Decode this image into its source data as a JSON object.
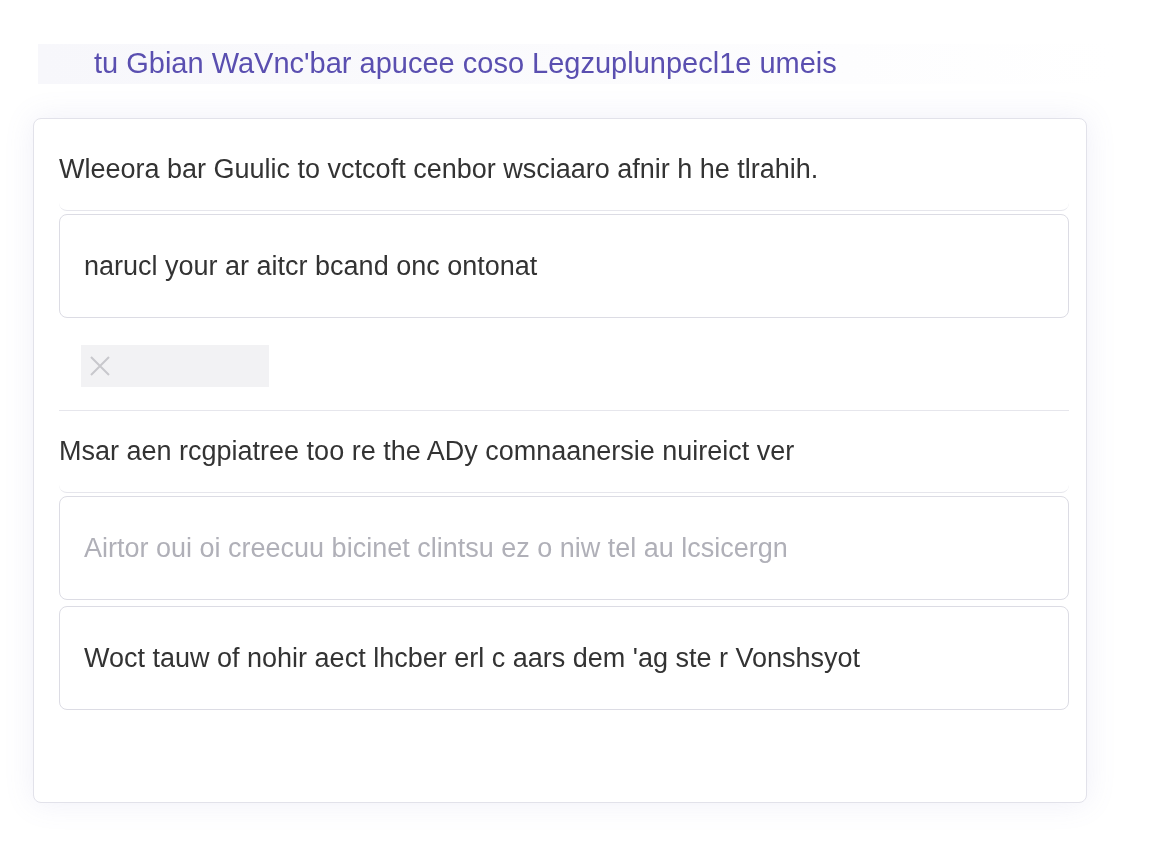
{
  "title": "tu Gbian WaVnc'bar apucee coso Legzuplunpecl1e umeis",
  "rows": [
    {
      "kind": "text",
      "text": "Wleeora bar Guulic to vctcoft cenbor wsciaaro afnir h he tlrahih."
    },
    {
      "kind": "field",
      "value": "narucl your ar aitcr bcand onc ontonat"
    },
    {
      "kind": "attach"
    },
    {
      "kind": "text",
      "text": "Msar aen rcgpiatree too re the ADy comnaanersie nuireict ver"
    },
    {
      "kind": "field",
      "placeholder": "Airtor oui oi creecuu bicinet clintsu ez o niw tel au lcsicergn"
    },
    {
      "kind": "field",
      "value": "Woct tauw of nohir aect lhcber erl c aars dem 'ag ste r Vonshsyot"
    }
  ]
}
